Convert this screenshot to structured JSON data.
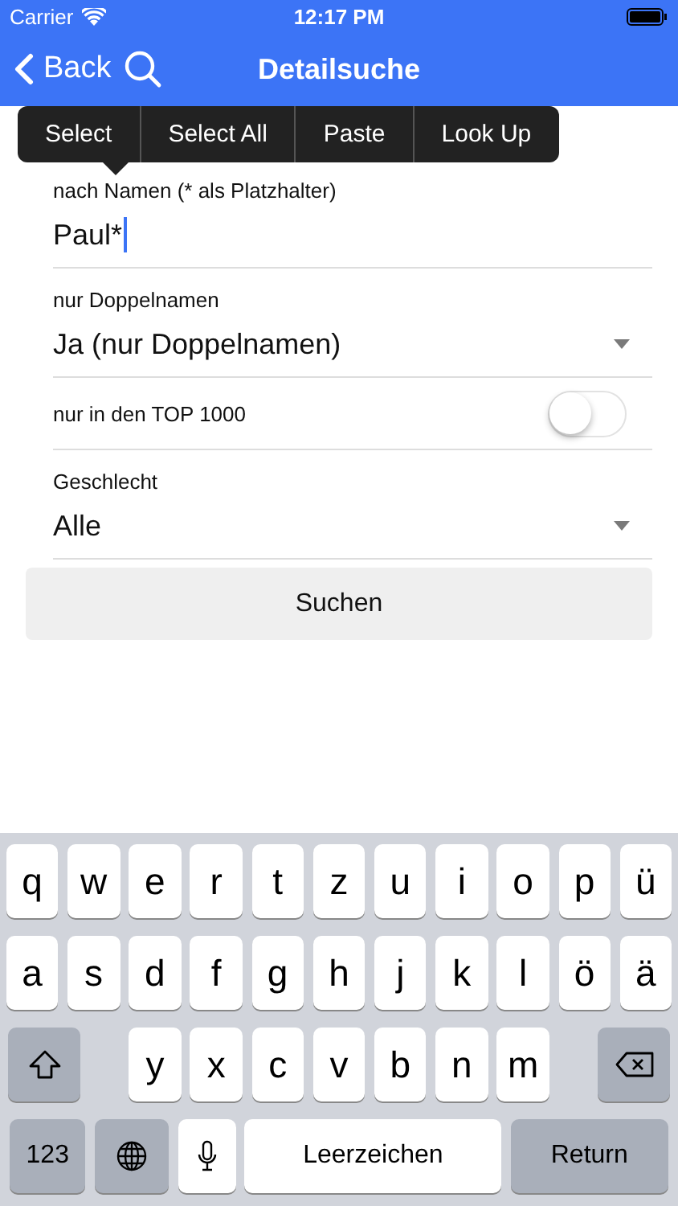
{
  "status_bar": {
    "carrier": "Carrier",
    "time": "12:17 PM"
  },
  "nav": {
    "back": "Back",
    "title": "Detailsuche"
  },
  "edit_menu": [
    "Select",
    "Select All",
    "Paste",
    "Look Up"
  ],
  "form": [
    {
      "kind": "text",
      "label": "nach Namen (* als Platzhalter)",
      "value": "Paul*"
    },
    {
      "kind": "select",
      "label": "nur Doppelnamen",
      "value": "Ja (nur Doppelnamen)"
    },
    {
      "kind": "switch",
      "label": "nur in den TOP 1000",
      "on": false
    },
    {
      "kind": "select",
      "label": "Geschlecht",
      "value": "Alle"
    }
  ],
  "search_button": "Suchen",
  "keyboard": {
    "rows": [
      {
        "keys": [
          {
            "kind": "char",
            "label": "q"
          },
          {
            "kind": "char",
            "label": "w"
          },
          {
            "kind": "char",
            "label": "e"
          },
          {
            "kind": "char",
            "label": "r"
          },
          {
            "kind": "char",
            "label": "t"
          },
          {
            "kind": "char",
            "label": "z"
          },
          {
            "kind": "char",
            "label": "u"
          },
          {
            "kind": "char",
            "label": "i"
          },
          {
            "kind": "char",
            "label": "o"
          },
          {
            "kind": "char",
            "label": "p"
          },
          {
            "kind": "char",
            "label": "ü"
          }
        ]
      },
      {
        "keys": [
          {
            "kind": "char",
            "label": "a"
          },
          {
            "kind": "char",
            "label": "s"
          },
          {
            "kind": "char",
            "label": "d"
          },
          {
            "kind": "char",
            "label": "f"
          },
          {
            "kind": "char",
            "label": "g"
          },
          {
            "kind": "char",
            "label": "h"
          },
          {
            "kind": "char",
            "label": "j"
          },
          {
            "kind": "char",
            "label": "k"
          },
          {
            "kind": "char",
            "label": "l"
          },
          {
            "kind": "char",
            "label": "ö"
          },
          {
            "kind": "char",
            "label": "ä"
          }
        ]
      },
      {
        "keys": [
          {
            "kind": "shift"
          },
          {
            "kind": "char",
            "label": "y"
          },
          {
            "kind": "char",
            "label": "x"
          },
          {
            "kind": "char",
            "label": "c"
          },
          {
            "kind": "char",
            "label": "v"
          },
          {
            "kind": "char",
            "label": "b"
          },
          {
            "kind": "char",
            "label": "n"
          },
          {
            "kind": "char",
            "label": "m"
          },
          {
            "kind": "delete"
          }
        ]
      },
      {
        "keys": [
          {
            "kind": "numbers",
            "label": "123"
          },
          {
            "kind": "globe"
          },
          {
            "kind": "mic"
          },
          {
            "kind": "space",
            "label": "Leerzeichen"
          },
          {
            "kind": "return",
            "label": "Return"
          }
        ]
      }
    ]
  }
}
